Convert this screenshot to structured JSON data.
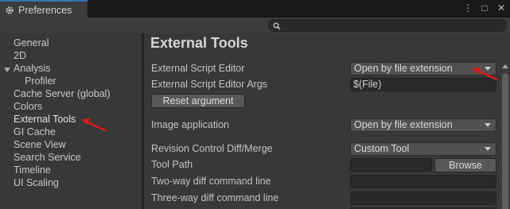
{
  "window": {
    "title": "Preferences",
    "controls": {
      "menu": "⋮",
      "maximize": "□",
      "close": "✕"
    }
  },
  "search": {
    "placeholder": "",
    "value": ""
  },
  "sidebar": {
    "items": [
      {
        "label": "General"
      },
      {
        "label": "2D"
      },
      {
        "label": "Analysis",
        "expanded": true
      },
      {
        "label": "Profiler",
        "child": true
      },
      {
        "label": "Cache Server (global)"
      },
      {
        "label": "Colors"
      },
      {
        "label": "External Tools",
        "selected": true
      },
      {
        "label": "GI Cache"
      },
      {
        "label": "Scene View"
      },
      {
        "label": "Search Service"
      },
      {
        "label": "Timeline"
      },
      {
        "label": "UI Scaling"
      }
    ]
  },
  "page": {
    "title": "External Tools",
    "script_editor": {
      "label": "External Script Editor",
      "value": "Open by file extension"
    },
    "script_editor_args": {
      "label": "External Script Editor Args",
      "value": "$(File)"
    },
    "reset_button": "Reset argument",
    "image_app": {
      "label": "Image application",
      "value": "Open by file extension"
    },
    "revision_diff": {
      "label": "Revision Control Diff/Merge",
      "value": "Custom Tool"
    },
    "tool_path": {
      "label": "Tool Path",
      "value": ""
    },
    "browse_button": "Browse",
    "two_way": {
      "label": "Two-way diff command line",
      "value": ""
    },
    "three_way": {
      "label": "Three-way diff command line",
      "value": ""
    }
  },
  "colors": {
    "accent": "#3a72b0",
    "annotation_arrow": "#e01818",
    "panel_bg": "#383838",
    "titlebar_bg": "#191919"
  }
}
